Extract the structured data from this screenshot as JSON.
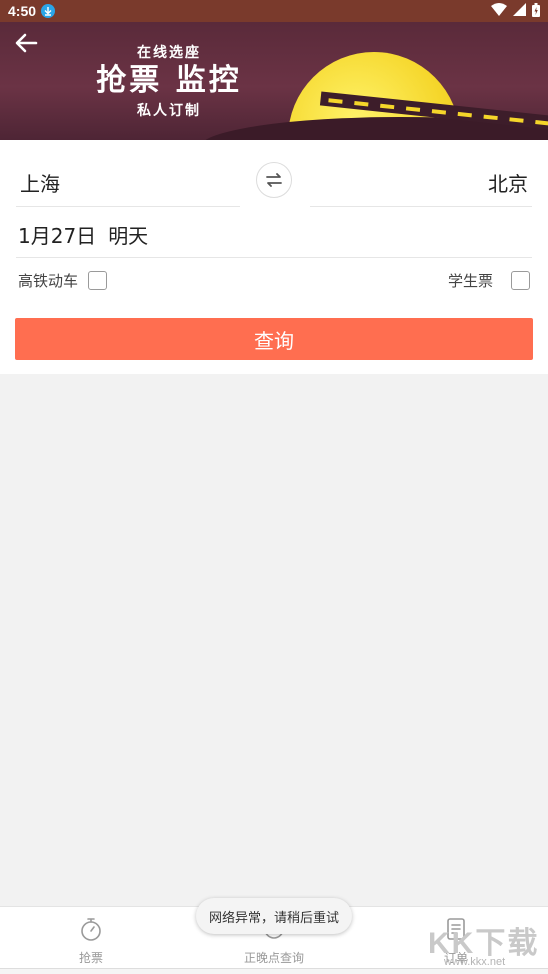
{
  "status_bar": {
    "time": "4:50",
    "icons": [
      "download-icon",
      "wifi-icon",
      "signal-icon",
      "battery-icon"
    ]
  },
  "banner": {
    "top_line": "在线选座",
    "main_line": "抢票 监控",
    "bottom_line": "私人订制",
    "icons": [
      "back-arrow-icon"
    ]
  },
  "form": {
    "from_station": "上海",
    "to_station": "北京",
    "date": "1月27日",
    "day_label": "明天",
    "option_left_label": "高铁动车",
    "option_left_checked": false,
    "option_right_label": "学生票",
    "option_right_checked": false,
    "query_label": "查询",
    "accent_color": "#ff6e50"
  },
  "bottom_nav": {
    "items": [
      {
        "label": "抢票",
        "icon": "stopwatch-icon"
      },
      {
        "label": "正晚点查询",
        "icon": "clock-icon"
      },
      {
        "label": "订单",
        "icon": "order-icon"
      }
    ]
  },
  "toast": {
    "message": "网络异常，请稍后重试"
  },
  "watermark": {
    "title": "KK下载",
    "url": "www.kkx.net"
  }
}
